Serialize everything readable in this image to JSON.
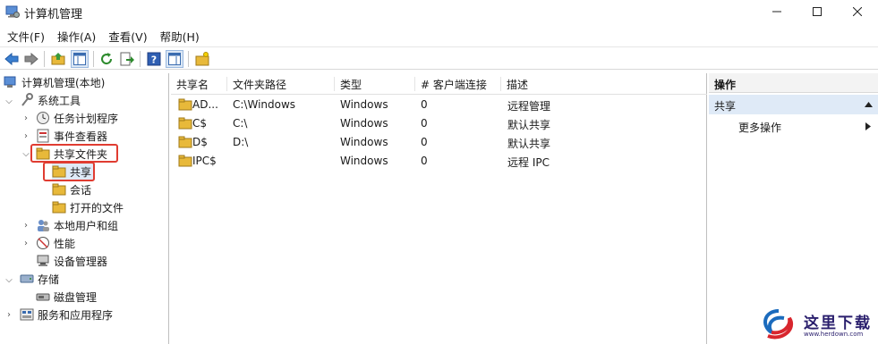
{
  "window": {
    "title": "计算机管理"
  },
  "menu": [
    "文件(F)",
    "操作(A)",
    "查看(V)",
    "帮助(H)"
  ],
  "tree": {
    "root": "计算机管理(本地)",
    "system_tools": "系统工具",
    "task_scheduler": "任务计划程序",
    "event_viewer": "事件查看器",
    "shared_folders": "共享文件夹",
    "shares": "共享",
    "sessions": "会话",
    "open_files": "打开的文件",
    "local_users": "本地用户和组",
    "performance": "性能",
    "device_manager": "设备管理器",
    "storage": "存储",
    "disk_management": "磁盘管理",
    "services_apps": "服务和应用程序"
  },
  "table": {
    "columns": [
      "共享名",
      "文件夹路径",
      "类型",
      "# 客户端连接",
      "描述"
    ],
    "rows": [
      {
        "name": "AD...",
        "path": "C:\\Windows",
        "type": "Windows",
        "clients": "0",
        "desc": "远程管理"
      },
      {
        "name": "C$",
        "path": "C:\\",
        "type": "Windows",
        "clients": "0",
        "desc": "默认共享"
      },
      {
        "name": "D$",
        "path": "D:\\",
        "type": "Windows",
        "clients": "0",
        "desc": "默认共享"
      },
      {
        "name": "IPC$",
        "path": "",
        "type": "Windows",
        "clients": "0",
        "desc": "远程 IPC"
      }
    ]
  },
  "actions": {
    "header": "操作",
    "selected": "共享",
    "more": "更多操作"
  },
  "watermark": {
    "text": "这里下载",
    "url": "www.herdown.com"
  },
  "colors": {
    "highlight_box": "#e03c31",
    "selection": "#dfeaf7",
    "folder": "#e8b93a"
  }
}
